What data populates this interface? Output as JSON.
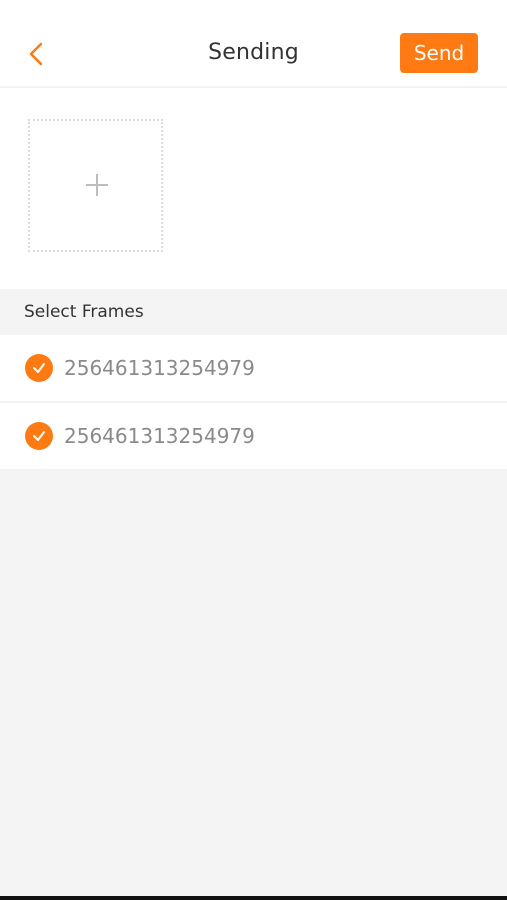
{
  "header": {
    "title": "Sending",
    "send_label": "Send",
    "back_icon": "chevron-left-icon"
  },
  "upload": {
    "add_icon": "plus-icon"
  },
  "section": {
    "title": "Select Frames"
  },
  "frames": [
    {
      "label": "256461313254979",
      "checked": true
    },
    {
      "label": "256461313254979",
      "checked": true
    }
  ],
  "colors": {
    "accent": "#ff7a12",
    "background": "#f4f4f4",
    "text_primary": "#333333",
    "text_secondary": "#8a8a8a"
  }
}
